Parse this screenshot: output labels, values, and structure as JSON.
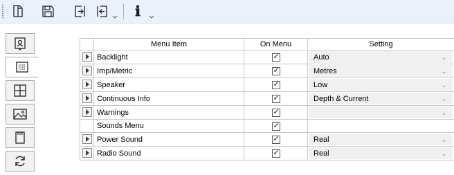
{
  "toolbar": {
    "buttons": [
      {
        "name": "open-file-icon"
      },
      {
        "name": "save-icon"
      },
      {
        "name": "export-icon"
      },
      {
        "name": "import-icon"
      },
      {
        "name": "info-icon",
        "glyph": "ℹ"
      }
    ]
  },
  "sidetabs": [
    {
      "name": "tab-contacts",
      "icon": "contact-card-icon"
    },
    {
      "name": "tab-menu",
      "icon": "list-icon",
      "active": true
    },
    {
      "name": "tab-grid",
      "icon": "grid-icon"
    },
    {
      "name": "tab-images",
      "icon": "image-icon"
    },
    {
      "name": "tab-memory",
      "icon": "sd-card-icon"
    },
    {
      "name": "tab-sync",
      "icon": "refresh-icon"
    }
  ],
  "grid": {
    "columns": [
      "Menu Item",
      "On Menu",
      "Setting"
    ],
    "rows": [
      {
        "item": "Backlight",
        "on_menu": true,
        "setting": "Auto",
        "has_arrow": true,
        "has_combo": true
      },
      {
        "item": "Imp/Metric",
        "on_menu": true,
        "setting": "Metres",
        "has_arrow": true,
        "has_combo": true
      },
      {
        "item": "Speaker",
        "on_menu": true,
        "setting": "Low",
        "has_arrow": true,
        "has_combo": true
      },
      {
        "item": "Continuous Info",
        "on_menu": true,
        "setting": "Depth & Current",
        "has_arrow": true,
        "has_combo": true
      },
      {
        "item": "Warnings",
        "on_menu": true,
        "setting": "",
        "has_arrow": true,
        "has_combo": true
      },
      {
        "item": "Sounds Menu",
        "on_menu": true,
        "setting": "",
        "has_arrow": false,
        "has_combo": false
      },
      {
        "item": "Power Sound",
        "on_menu": true,
        "setting": "Real",
        "has_arrow": true,
        "has_combo": true
      },
      {
        "item": "Radio Sound",
        "on_menu": true,
        "setting": "Real",
        "has_arrow": true,
        "has_combo": true
      }
    ]
  }
}
